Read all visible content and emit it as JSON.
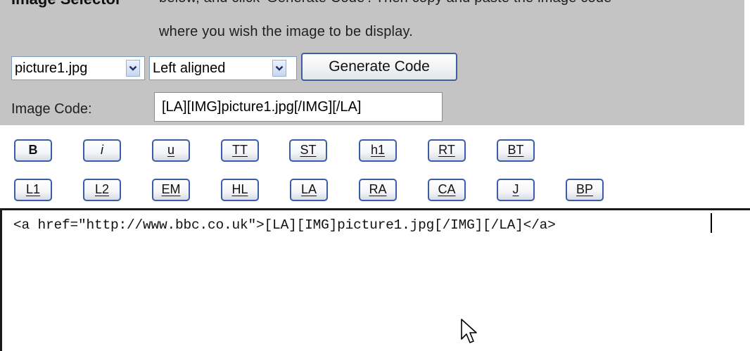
{
  "panel": {
    "title": "Image Selector",
    "instructions_line1": "below, and click 'Generate Code'. Then copy and paste the image code",
    "instructions_line2": "where you wish the image to be display.",
    "file_select_value": "picture1.jpg",
    "align_select_value": "Left aligned",
    "generate_button_label": "Generate Code",
    "code_label": "Image Code:",
    "code_value": "[LA][IMG]picture1.jpg[/IMG][/LA]"
  },
  "format_buttons": {
    "row1": [
      "B",
      "i",
      "u",
      "TT",
      "ST",
      "h1",
      "RT",
      "BT"
    ],
    "row2": [
      "L1",
      "L2",
      "EM",
      "HL",
      "LA",
      "RA",
      "CA",
      "J",
      "BP"
    ]
  },
  "editor": {
    "text": "<a href=\"http://www.bbc.co.uk\">[LA][IMG]picture1.jpg[/IMG][/LA]</a>"
  },
  "colors": {
    "panel_bg": "#c4c4c4",
    "button_border": "#3a5da8",
    "input_border": "#7f9db9"
  }
}
